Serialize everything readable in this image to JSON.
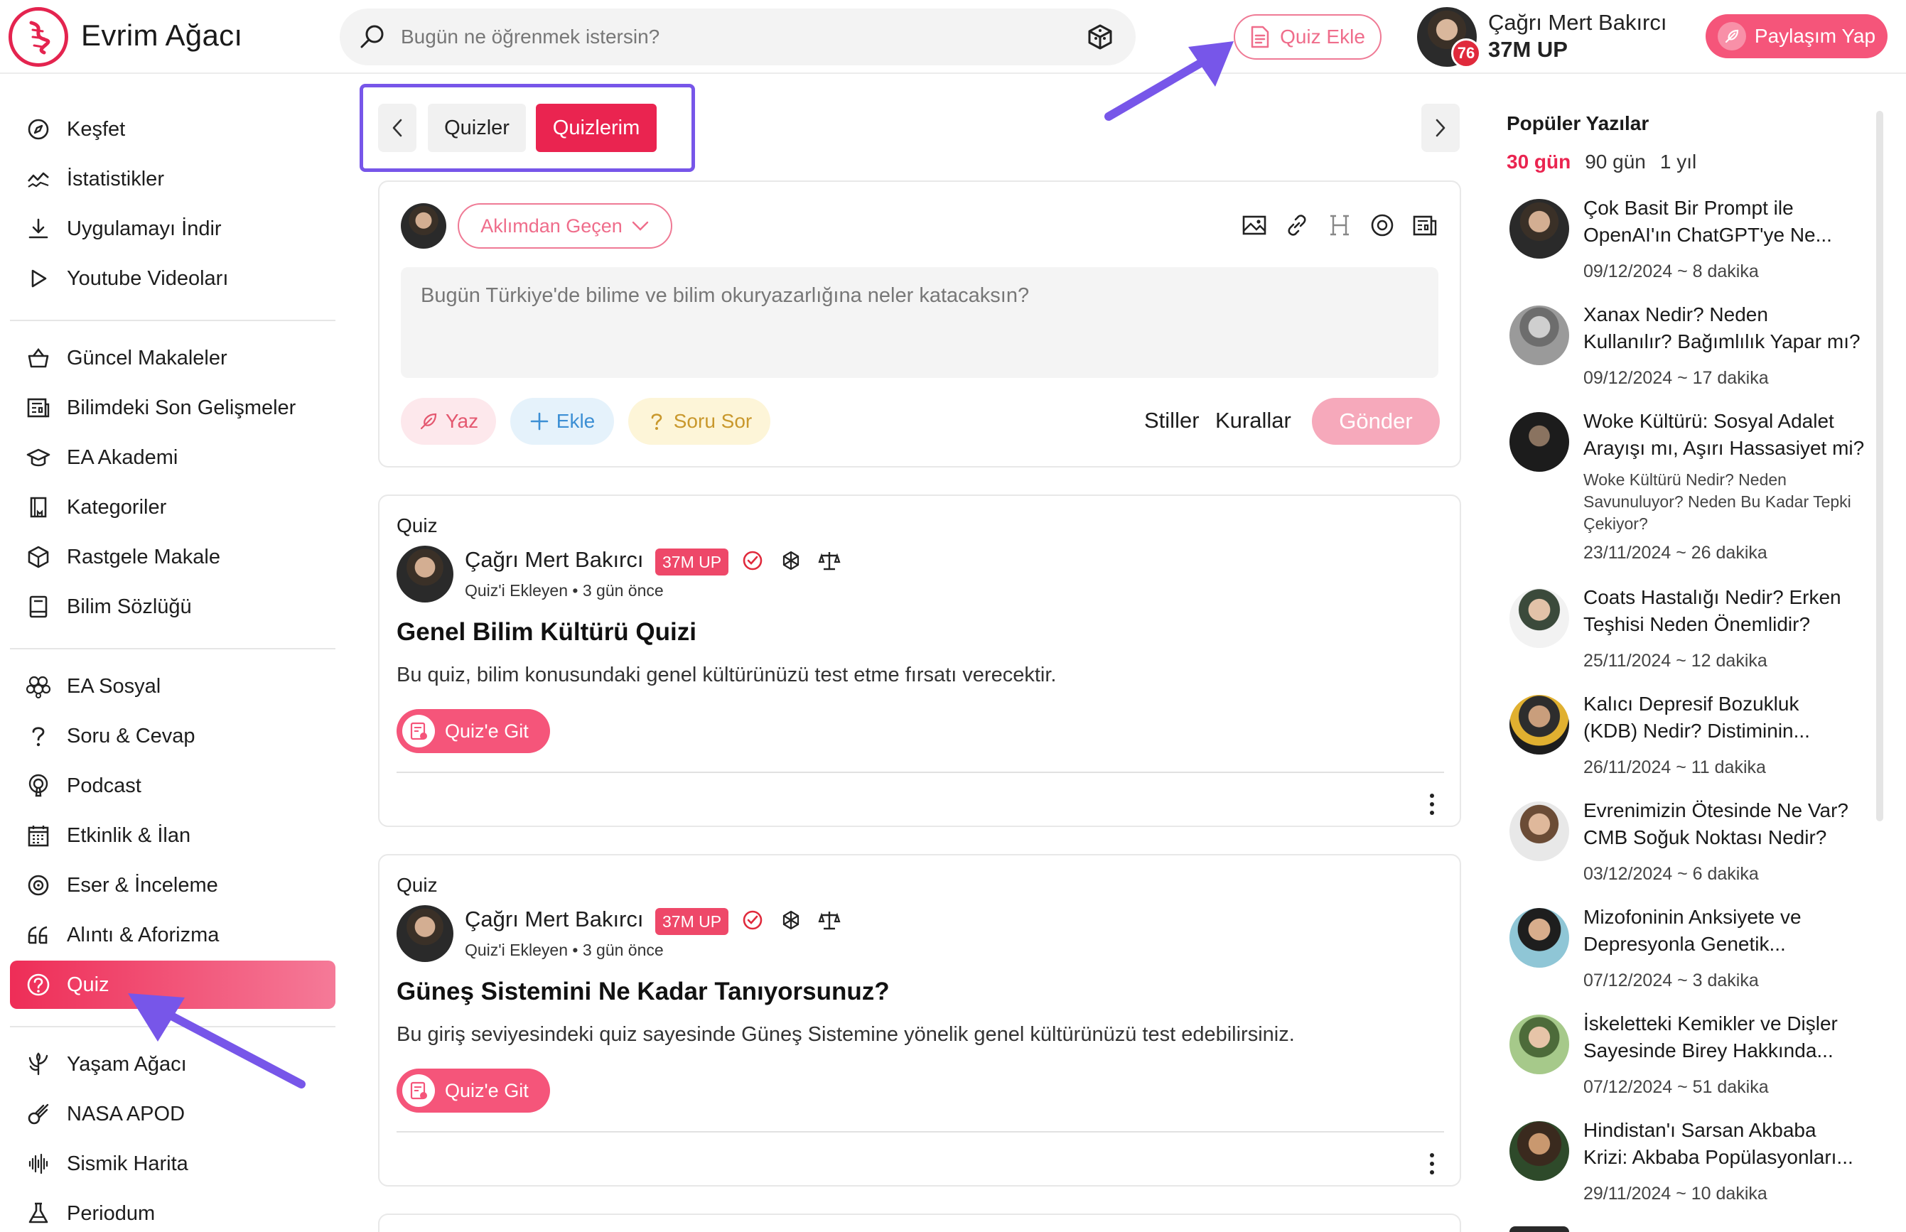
{
  "header": {
    "logo_text": "Evrim Ağacı",
    "search_placeholder": "Bugün ne öğrenmek istersin?",
    "quiz_add_label": "Quiz Ekle",
    "user_name": "Çağrı Mert Bakırcı",
    "user_up": "37M UP",
    "notification_count": "76",
    "share_label": "Paylaşım Yap"
  },
  "sidebar": {
    "items": [
      {
        "label": "Keşfet",
        "icon": "compass-icon"
      },
      {
        "label": "İstatistikler",
        "icon": "stats-icon"
      },
      {
        "label": "Uygulamayı İndir",
        "icon": "download-icon"
      },
      {
        "label": "Youtube Videoları",
        "icon": "play-icon"
      },
      {
        "label": "Güncel Makaleler",
        "icon": "basket-icon"
      },
      {
        "label": "Bilimdeki Son Gelişmeler",
        "icon": "newspaper-icon"
      },
      {
        "label": "EA Akademi",
        "icon": "graduation-cap-icon"
      },
      {
        "label": "Kategoriler",
        "icon": "book-icon"
      },
      {
        "label": "Rastgele Makale",
        "icon": "dice-icon"
      },
      {
        "label": "Bilim Sözlüğü",
        "icon": "dictionary-icon"
      },
      {
        "label": "EA Sosyal",
        "icon": "hexagons-icon"
      },
      {
        "label": "Soru & Cevap",
        "icon": "question-icon"
      },
      {
        "label": "Podcast",
        "icon": "podcast-icon"
      },
      {
        "label": "Etkinlik & İlan",
        "icon": "calendar-icon"
      },
      {
        "label": "Eser & İnceleme",
        "icon": "disc-icon"
      },
      {
        "label": "Alıntı & Aforizma",
        "icon": "quote-icon"
      },
      {
        "label": "Quiz",
        "icon": "quiz-icon"
      },
      {
        "label": "Yaşam Ağacı",
        "icon": "tree-icon"
      },
      {
        "label": "NASA APOD",
        "icon": "comet-icon"
      },
      {
        "label": "Sismik Harita",
        "icon": "seismic-icon"
      },
      {
        "label": "Periodum",
        "icon": "flask-icon"
      }
    ],
    "active_index": 16
  },
  "tabs": {
    "quizler": "Quizler",
    "quizlerim": "Quizlerim"
  },
  "composer": {
    "category_label": "Aklımdan Geçen",
    "placeholder": "Bugün Türkiye'de bilime ve bilim okuryazarlığına neler katacaksın?",
    "write_label": "Yaz",
    "add_label": "Ekle",
    "ask_label": "Soru Sor",
    "styles_label": "Stiller",
    "rules_label": "Kurallar",
    "send_label": "Gönder"
  },
  "quizzes": [
    {
      "kind": "Quiz",
      "author": "Çağrı Mert Bakırcı",
      "up": "37M UP",
      "role": "Quiz'i Ekleyen",
      "time": "3 gün önce",
      "title": "Genel Bilim Kültürü Quizi",
      "description": "Bu quiz, bilim konusundaki genel kültürünüzü test etme fırsatı verecektir.",
      "button": "Quiz'e Git"
    },
    {
      "kind": "Quiz",
      "author": "Çağrı Mert Bakırcı",
      "up": "37M UP",
      "role": "Quiz'i Ekleyen",
      "time": "3 gün önce",
      "title": "Güneş Sistemini Ne Kadar Tanıyorsunuz?",
      "description": "Bu giriş seviyesindeki quiz sayesinde Güneş Sistemine yönelik genel kültürünüzü test edebilirsiniz.",
      "button": "Quiz'e Git"
    }
  ],
  "popular": {
    "title": "Popüler Yazılar",
    "periods": [
      "30 gün",
      "90 gün",
      "1 yıl"
    ],
    "active_period": 0,
    "posts": [
      {
        "title_1": "Çok Basit Bir Prompt ile",
        "title_2": "OpenAI'ın ChatGPT'ye Ne...",
        "meta": "09/12/2024 ~ 8 dakika"
      },
      {
        "title_1": "Xanax Nedir? Neden",
        "title_2": "Kullanılır? Bağımlılık Yapar mı?",
        "meta": "09/12/2024 ~ 17 dakika"
      },
      {
        "title_1": "Woke Kültürü: Sosyal Adalet",
        "title_2": "Arayışı mı, Aşırı Hassasiyet mi?",
        "sub_1": "Woke Kültürü Nedir? Neden",
        "sub_2": "Savunuluyor? Neden Bu Kadar Tepki",
        "sub_3": "Çekiyor?",
        "meta": "23/11/2024 ~ 26 dakika"
      },
      {
        "title_1": "Coats Hastalığı Nedir? Erken",
        "title_2": "Teşhisi Neden Önemlidir?",
        "meta": "25/11/2024 ~ 12 dakika"
      },
      {
        "title_1": "Kalıcı Depresif Bozukluk",
        "title_2": "(KDB) Nedir? Distiminin...",
        "meta": "26/11/2024 ~ 11 dakika"
      },
      {
        "title_1": "Evrenimizin Ötesinde Ne Var?",
        "title_2": "CMB Soğuk Noktası Nedir?",
        "meta": "03/12/2024 ~ 6 dakika"
      },
      {
        "title_1": "Mizofoninin Anksiyete ve",
        "title_2": "Depresyonla Genetik...",
        "meta": "07/12/2024 ~ 3 dakika"
      },
      {
        "title_1": "İskeletteki Kemikler ve Dişler",
        "title_2": "Sayesinde Birey Hakkında...",
        "meta": "07/12/2024 ~ 51 dakika"
      },
      {
        "title_1": "Hindistan'ı Sarsan Akbaba",
        "title_2": "Krizi: Akbaba Popülasyonları...",
        "meta": "29/11/2024 ~ 10 dakika"
      }
    ]
  },
  "colors": {
    "accent": "#ea2450",
    "accent_light": "#f5557a",
    "annotation": "#7756e9"
  }
}
